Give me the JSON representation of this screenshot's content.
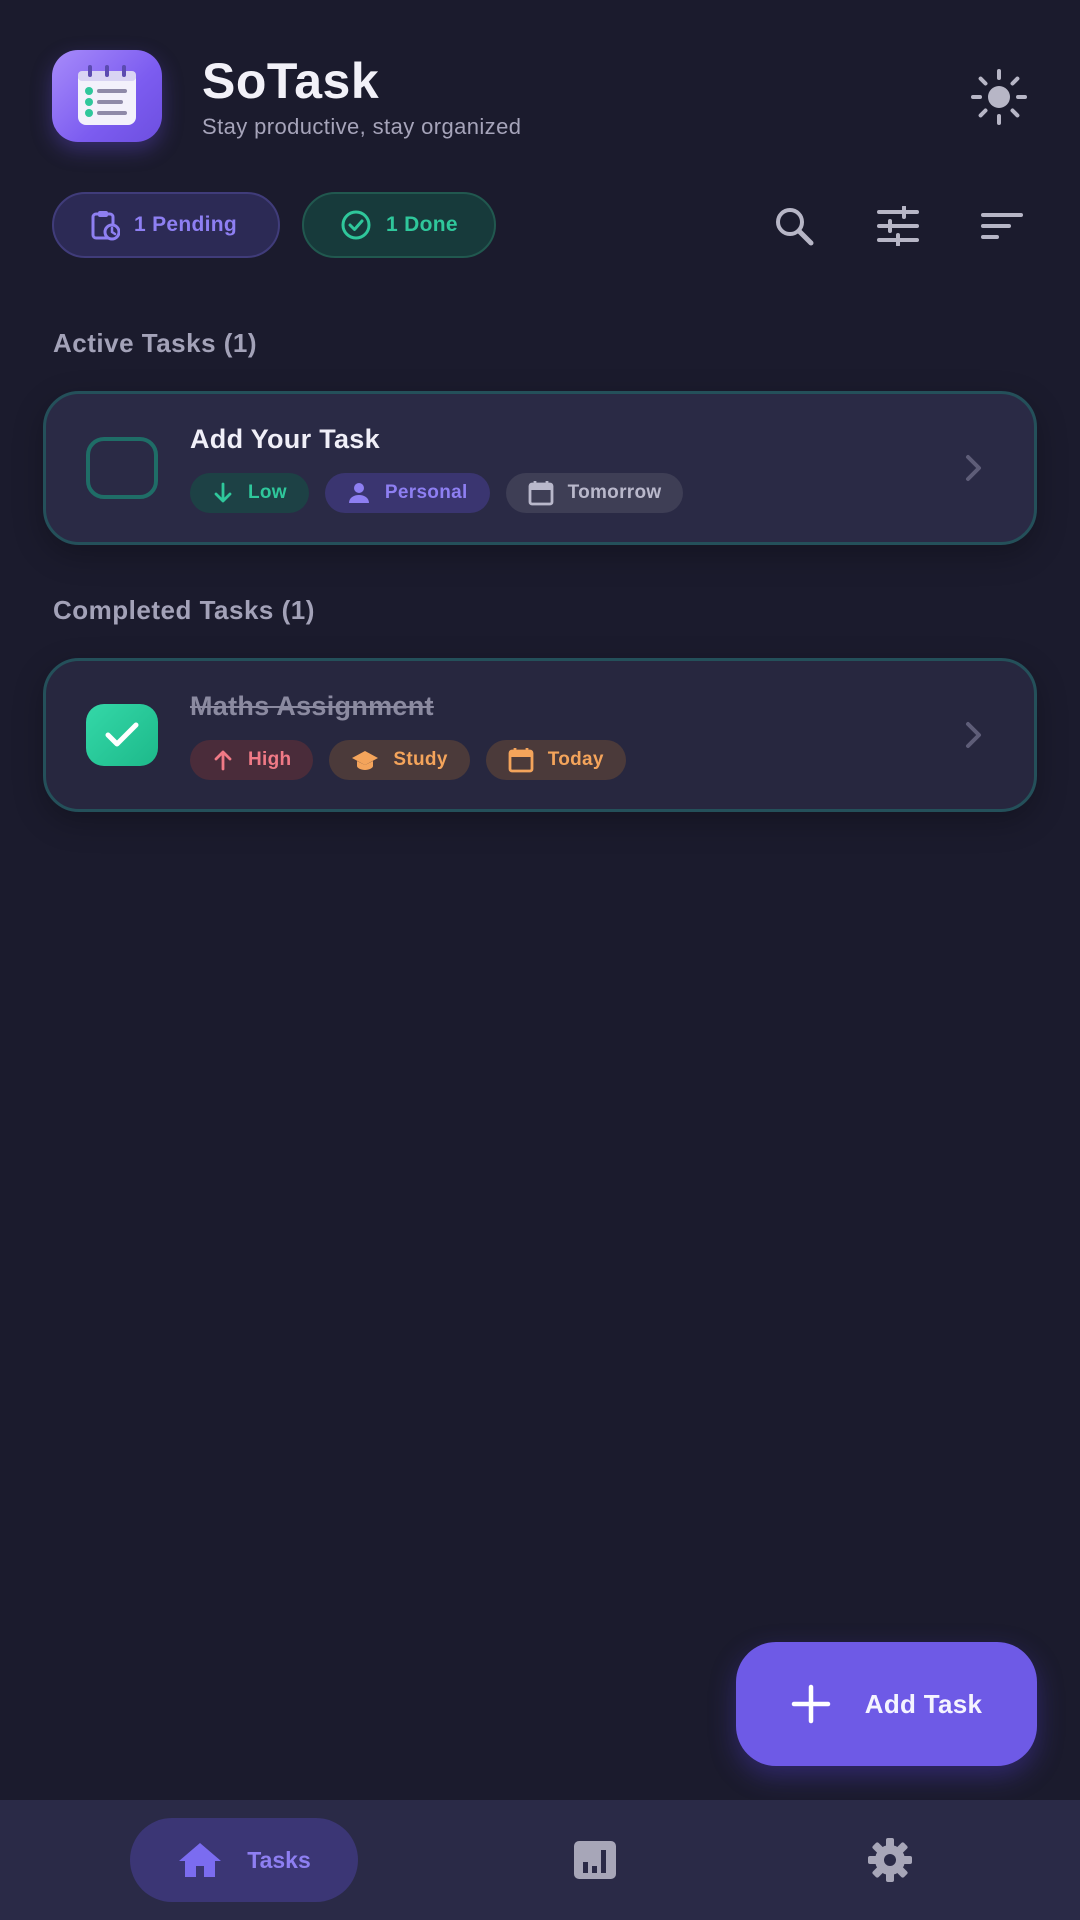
{
  "header": {
    "title": "SoTask",
    "subtitle": "Stay productive, stay organized"
  },
  "stats": {
    "pending_label": "1 Pending",
    "done_label": "1 Done"
  },
  "sections": {
    "active_title": "Active Tasks (1)",
    "completed_title": "Completed Tasks (1)"
  },
  "active_tasks": [
    {
      "title": "Add Your Task",
      "priority": "Low",
      "category": "Personal",
      "due": "Tomorrow"
    }
  ],
  "completed_tasks": [
    {
      "title": "Maths Assignment",
      "priority": "High",
      "category": "Study",
      "due": "Today"
    }
  ],
  "fab": {
    "label": "Add Task"
  },
  "nav": {
    "tasks_label": "Tasks"
  },
  "colors": {
    "background": "#1b1b2d",
    "accent": "#6e5ae6",
    "success": "#2fc79b",
    "danger": "#f07a86",
    "warning": "#f4a45b"
  }
}
